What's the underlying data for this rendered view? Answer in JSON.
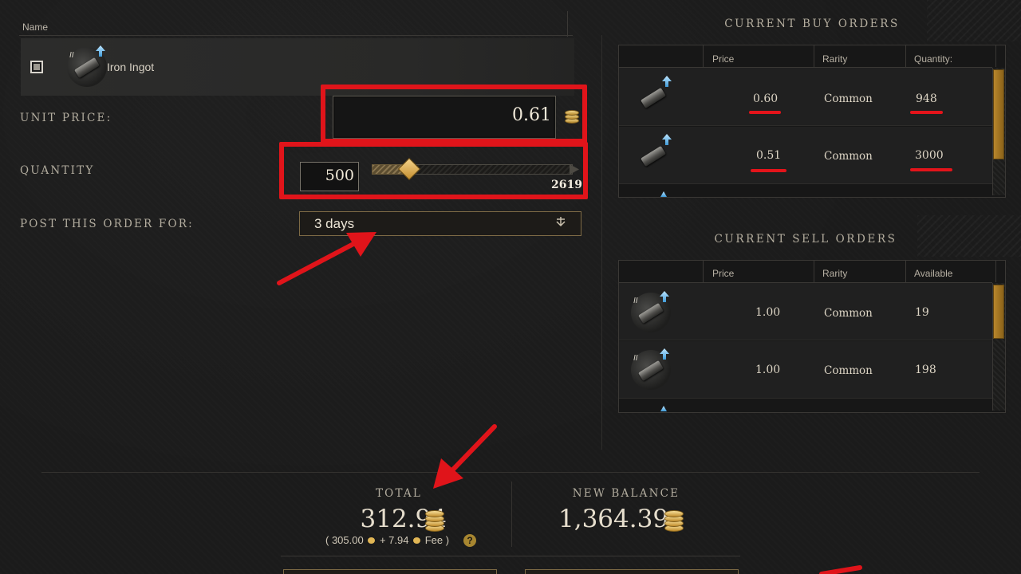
{
  "item_list": {
    "header_name": "Name",
    "item": {
      "name": "Iron Ingot",
      "tier": "II",
      "checked": true
    }
  },
  "order_form": {
    "unit_price_label": "UNIT PRICE:",
    "unit_price": "0.61",
    "quantity_label": "QUANTITY",
    "quantity": "500",
    "quantity_max": "2619",
    "quantity_fraction": 0.19,
    "post_label": "POST THIS ORDER FOR:",
    "duration": "3 days"
  },
  "buy_orders": {
    "title": "CURRENT BUY ORDERS",
    "columns": [
      "Price",
      "Rarity",
      "Quantity:"
    ],
    "rows": [
      {
        "price": "0.60",
        "rarity": "Common",
        "quantity": "948"
      },
      {
        "price": "0.51",
        "rarity": "Common",
        "quantity": "3000"
      }
    ]
  },
  "sell_orders": {
    "title": "CURRENT SELL ORDERS",
    "columns": [
      "Price",
      "Rarity",
      "Available"
    ],
    "rows": [
      {
        "price": "1.00",
        "rarity": "Common",
        "available": "19"
      },
      {
        "price": "1.00",
        "rarity": "Common",
        "available": "198"
      }
    ]
  },
  "totals": {
    "total_label": "TOTAL",
    "total_value": "312.94",
    "breakdown_open": "( 305.00",
    "breakdown_plus": "+ 7.94",
    "breakdown_fee": "Fee )",
    "help": "?",
    "balance_label": "NEW BALANCE",
    "balance_value": "1,364.39"
  },
  "colors": {
    "highlight_red": "#e0141a",
    "gold": "#c48f30",
    "background": "#1b1b1b"
  },
  "icons": [
    "iron-ingot-icon",
    "upgrade-arrow-icon",
    "coin-icon",
    "coin-stack-icon",
    "chevron-down-icon",
    "help-icon"
  ]
}
